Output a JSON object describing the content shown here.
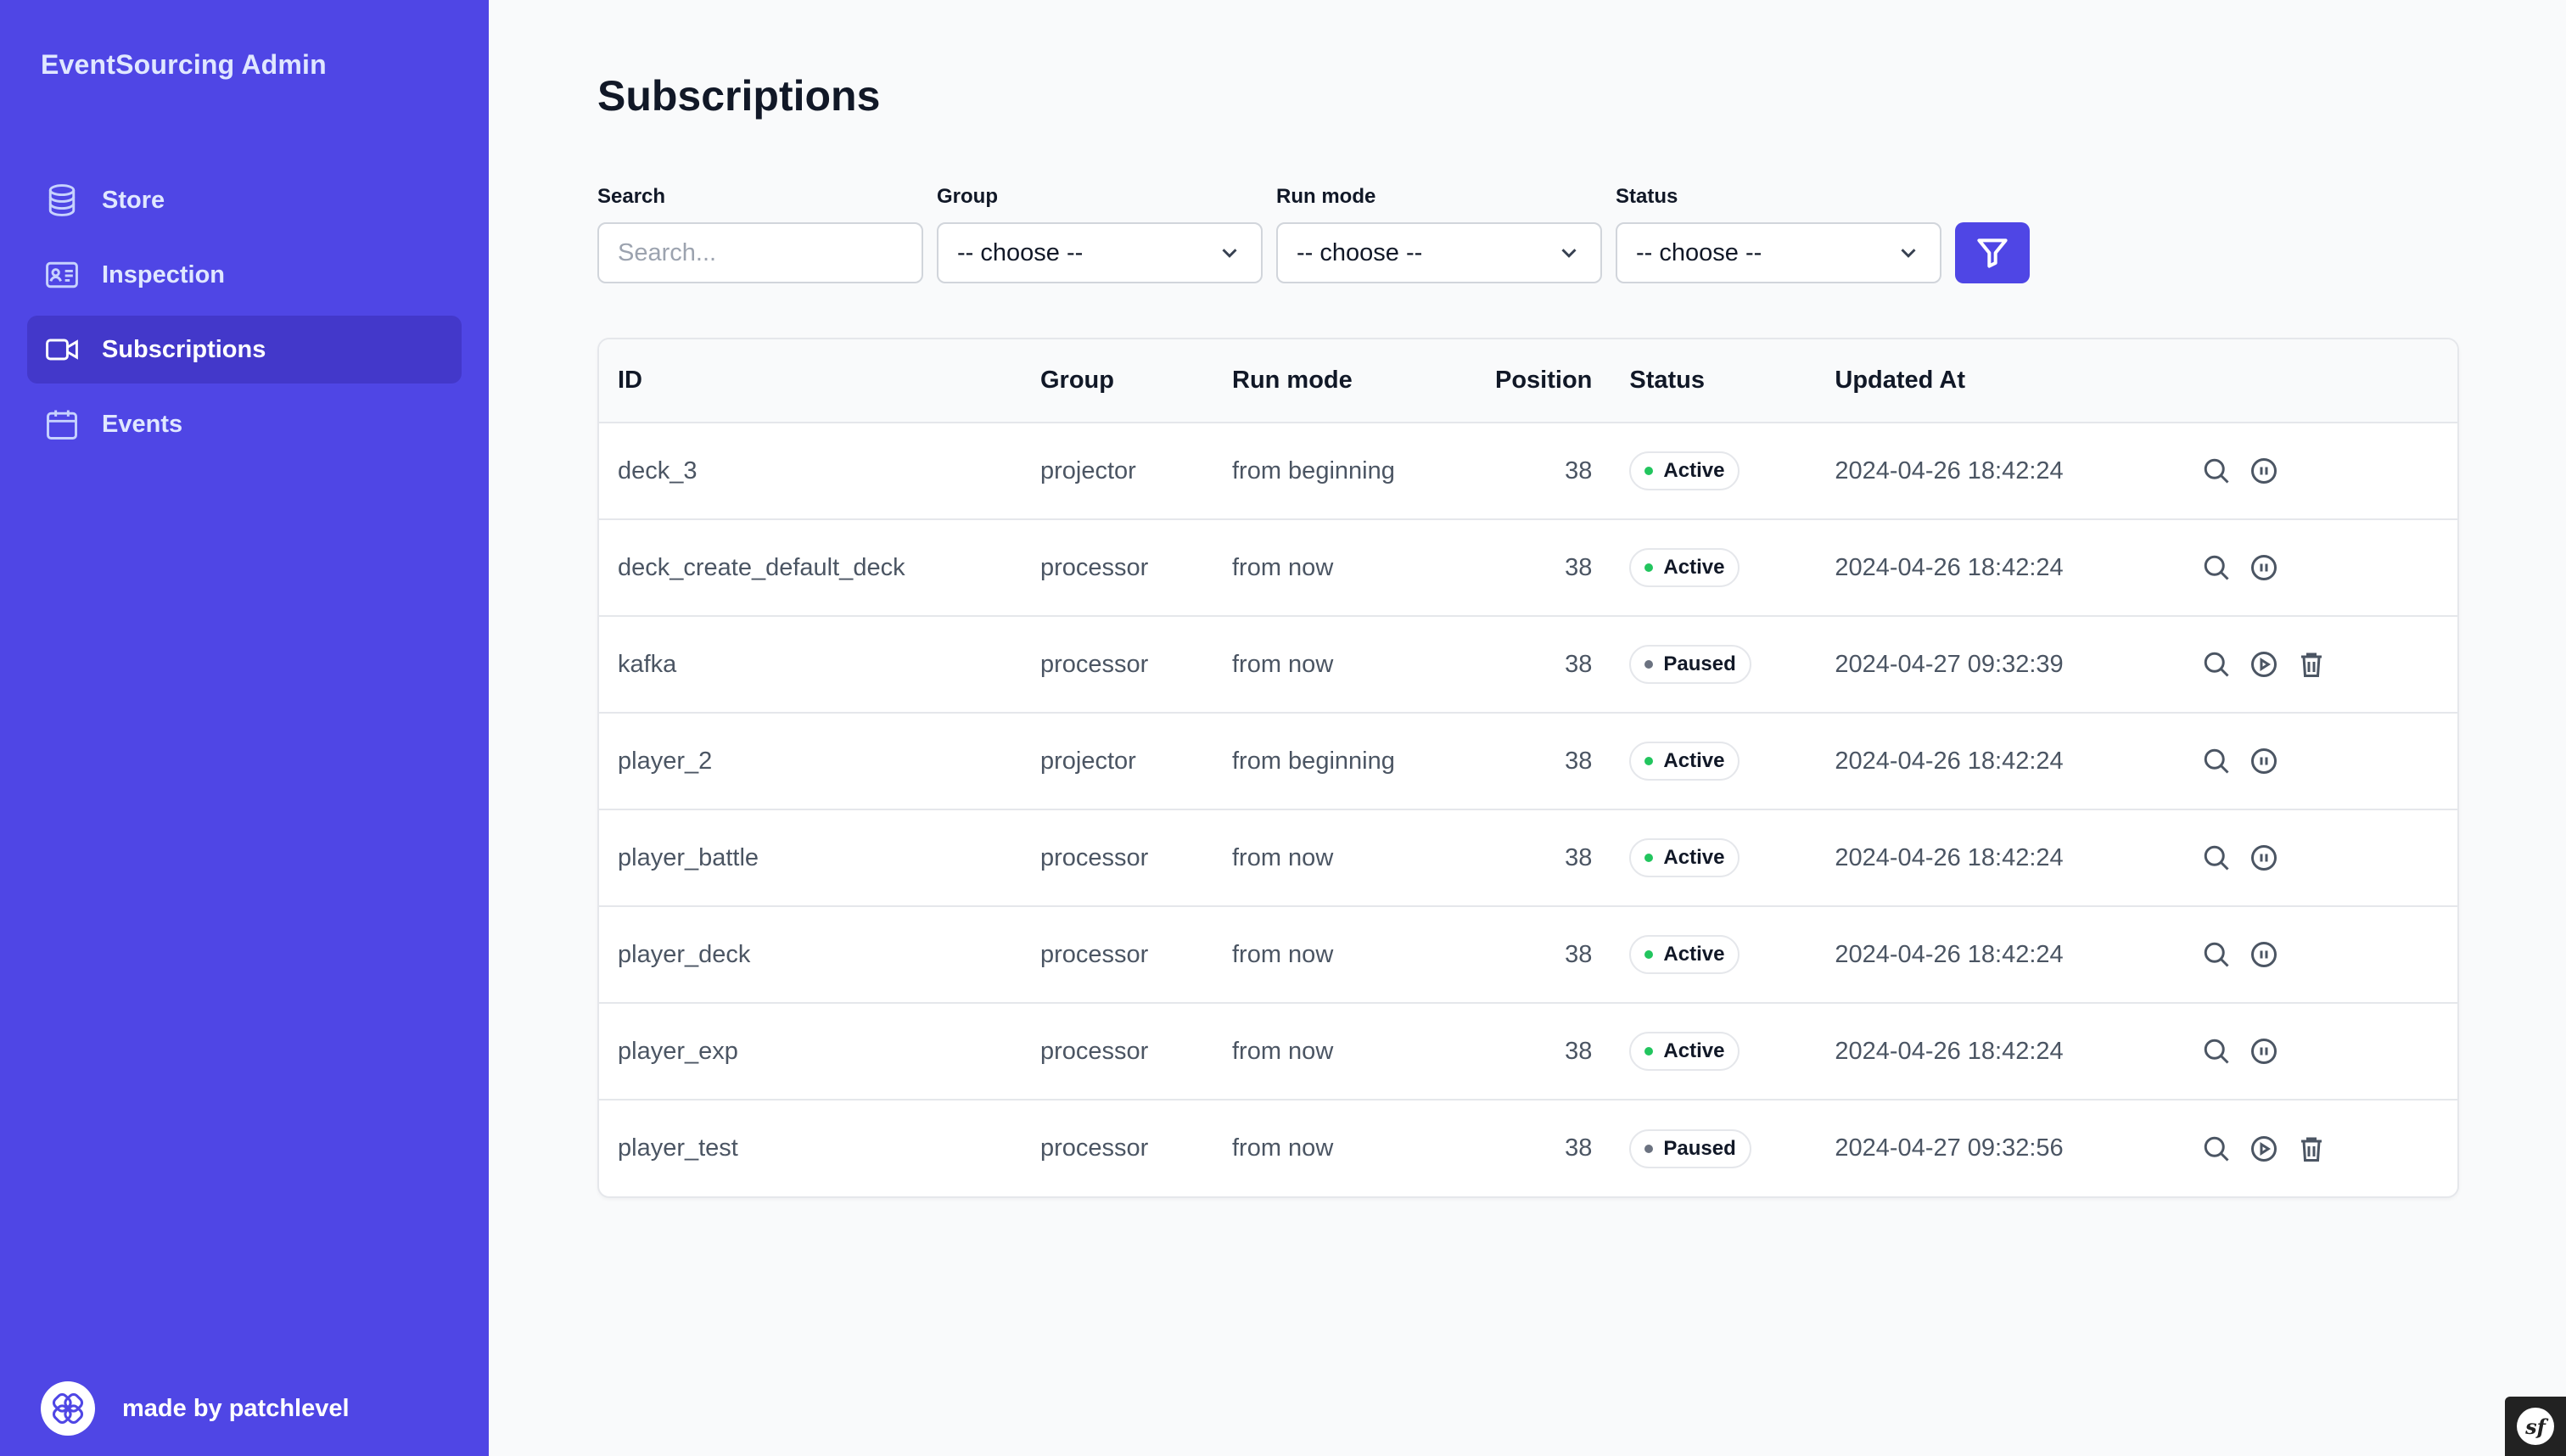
{
  "app": {
    "brand": "EventSourcing Admin",
    "footer": "made by patchlevel"
  },
  "sidebar": {
    "items": [
      {
        "label": "Store",
        "icon": "database-icon",
        "active": false
      },
      {
        "label": "Inspection",
        "icon": "id-card-icon",
        "active": false
      },
      {
        "label": "Subscriptions",
        "icon": "video-camera-icon",
        "active": true
      },
      {
        "label": "Events",
        "icon": "calendar-icon",
        "active": false
      }
    ]
  },
  "page": {
    "title": "Subscriptions"
  },
  "filters": {
    "search": {
      "label": "Search",
      "placeholder": "Search...",
      "value": ""
    },
    "group": {
      "label": "Group",
      "selected": "-- choose --"
    },
    "run_mode": {
      "label": "Run mode",
      "selected": "-- choose --"
    },
    "status": {
      "label": "Status",
      "selected": "-- choose --"
    },
    "submit_icon": "filter-icon"
  },
  "table": {
    "headers": {
      "id": "ID",
      "group": "Group",
      "run_mode": "Run mode",
      "position": "Position",
      "status": "Status",
      "updated_at": "Updated At"
    },
    "rows": [
      {
        "id": "deck_3",
        "group": "projector",
        "run_mode": "from beginning",
        "position": "38",
        "status": "Active",
        "updated_at": "2024-04-26 18:42:24"
      },
      {
        "id": "deck_create_default_deck",
        "group": "processor",
        "run_mode": "from now",
        "position": "38",
        "status": "Active",
        "updated_at": "2024-04-26 18:42:24"
      },
      {
        "id": "kafka",
        "group": "processor",
        "run_mode": "from now",
        "position": "38",
        "status": "Paused",
        "updated_at": "2024-04-27 09:32:39"
      },
      {
        "id": "player_2",
        "group": "projector",
        "run_mode": "from beginning",
        "position": "38",
        "status": "Active",
        "updated_at": "2024-04-26 18:42:24"
      },
      {
        "id": "player_battle",
        "group": "processor",
        "run_mode": "from now",
        "position": "38",
        "status": "Active",
        "updated_at": "2024-04-26 18:42:24"
      },
      {
        "id": "player_deck",
        "group": "processor",
        "run_mode": "from now",
        "position": "38",
        "status": "Active",
        "updated_at": "2024-04-26 18:42:24"
      },
      {
        "id": "player_exp",
        "group": "processor",
        "run_mode": "from now",
        "position": "38",
        "status": "Active",
        "updated_at": "2024-04-26 18:42:24"
      },
      {
        "id": "player_test",
        "group": "processor",
        "run_mode": "from now",
        "position": "38",
        "status": "Paused",
        "updated_at": "2024-04-27 09:32:56"
      }
    ]
  },
  "colors": {
    "sidebar": "#4f46e5",
    "sidebar_active": "#4338ca",
    "active_dot": "#22c55e",
    "paused_dot": "#6b7280"
  }
}
